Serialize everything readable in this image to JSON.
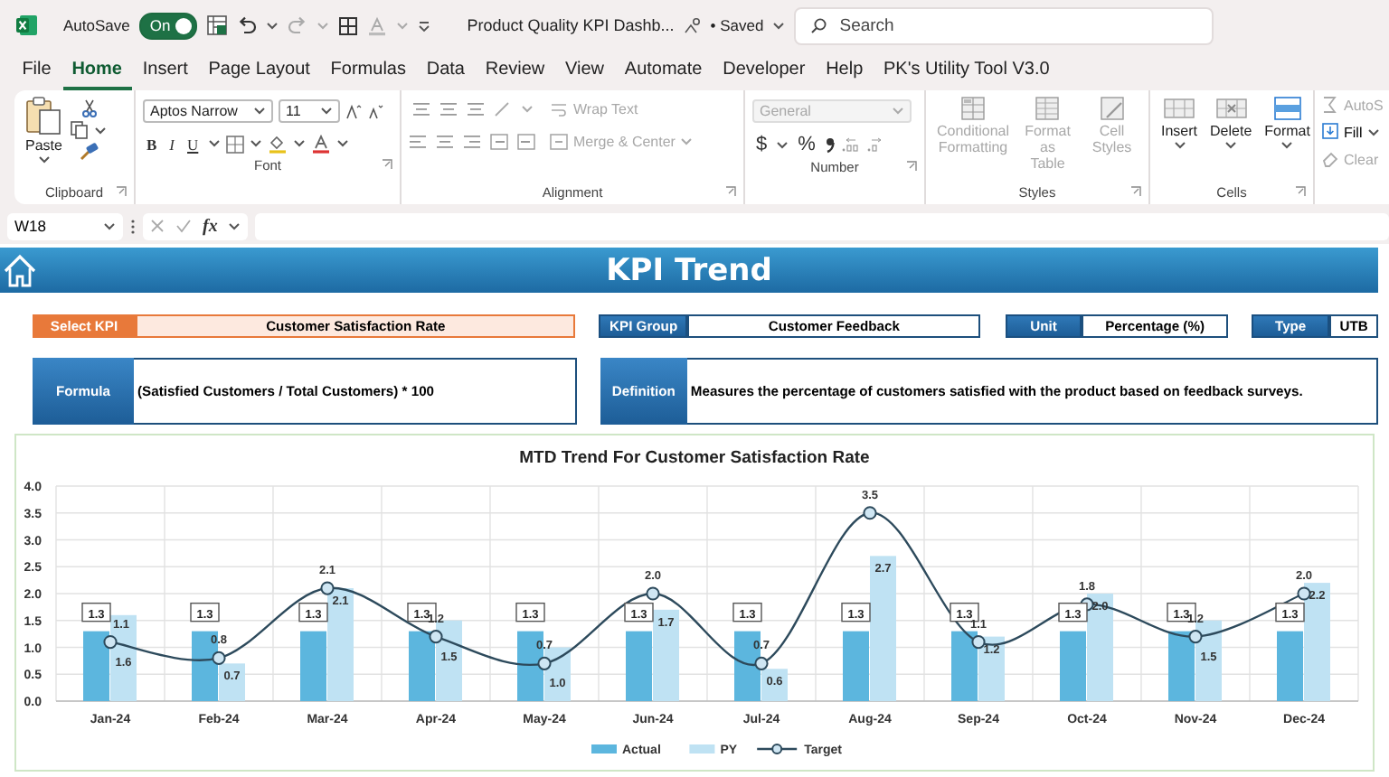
{
  "title_bar": {
    "autosave_label": "AutoSave",
    "autosave": {
      "label": "On",
      "on": true
    },
    "document_title": "Product Quality KPI Dashb...",
    "save_status": "• Saved",
    "search": {
      "placeholder": "Search"
    }
  },
  "tabs": [
    {
      "label": "File",
      "selected": false
    },
    {
      "label": "Home",
      "selected": true
    },
    {
      "label": "Insert",
      "selected": false
    },
    {
      "label": "Page Layout",
      "selected": false
    },
    {
      "label": "Formulas",
      "selected": false
    },
    {
      "label": "Data",
      "selected": false
    },
    {
      "label": "Review",
      "selected": false
    },
    {
      "label": "View",
      "selected": false
    },
    {
      "label": "Automate",
      "selected": false
    },
    {
      "label": "Developer",
      "selected": false
    },
    {
      "label": "Help",
      "selected": false
    },
    {
      "label": "PK's Utility Tool V3.0",
      "selected": false
    }
  ],
  "ribbon": {
    "clipboard": {
      "label": "Clipboard",
      "paste": "Paste"
    },
    "font": {
      "label": "Font",
      "font_name": "Aptos Narrow",
      "font_size": "11",
      "styles": [
        "B",
        "I",
        "U"
      ]
    },
    "alignment": {
      "label": "Alignment",
      "commands": [
        {
          "label": "Wrap Text",
          "disabled": true
        },
        {
          "label": "Merge & Center",
          "disabled": true
        }
      ]
    },
    "number": {
      "label": "Number",
      "format": {
        "value": "General",
        "disabled": true
      },
      "symbols": [
        "$",
        "%"
      ]
    },
    "styles": {
      "label": "Styles",
      "commands": [
        {
          "label": "Conditional Formatting",
          "disabled": true
        },
        {
          "label": "Format as Table",
          "disabled": true
        },
        {
          "label": "Cell Styles",
          "disabled": true
        }
      ]
    },
    "cells": {
      "label": "Cells",
      "commands": [
        {
          "label": "Insert",
          "disabled": false
        },
        {
          "label": "Delete",
          "disabled": false
        },
        {
          "label": "Format",
          "disabled": false
        }
      ]
    },
    "editing": {
      "commands": [
        {
          "label": "AutoS",
          "disabled": true
        },
        {
          "label": "Fill",
          "disabled": false
        },
        {
          "label": "Clear",
          "disabled": true
        }
      ]
    }
  },
  "formula_bar": {
    "name_box": "W18",
    "function_button": "fx"
  },
  "sheet": {
    "banner_title": "KPI Trend",
    "fields": [
      {
        "label": "Select KPI",
        "value": "Customer Satisfaction Rate",
        "kind": "select"
      },
      {
        "label": "KPI Group",
        "value": "Customer Feedback",
        "kind": "info"
      },
      {
        "label": "Unit",
        "value": "Percentage (%)",
        "kind": "info"
      },
      {
        "label": "Type",
        "value": "UTB",
        "kind": "info"
      }
    ],
    "details": [
      {
        "label": "Formula",
        "text": "(Satisfied Customers / Total Customers) * 100"
      },
      {
        "label": "Definition",
        "text": "Measures the percentage of customers satisfied with the product based on feedback surveys."
      }
    ],
    "chart_data": {
      "type": "bar",
      "title": "MTD Trend For Customer Satisfaction Rate",
      "categories": [
        "Jan-24",
        "Feb-24",
        "Mar-24",
        "Apr-24",
        "May-24",
        "Jun-24",
        "Jul-24",
        "Aug-24",
        "Sep-24",
        "Oct-24",
        "Nov-24",
        "Dec-24"
      ],
      "series": [
        {
          "name": "Actual",
          "type": "bar",
          "color": "#5cb6de",
          "values": [
            1.3,
            1.3,
            1.3,
            1.3,
            1.3,
            1.3,
            1.3,
            1.3,
            1.3,
            1.3,
            1.3,
            1.3
          ]
        },
        {
          "name": "PY",
          "type": "bar",
          "color": "#bfe2f3",
          "values": [
            1.6,
            0.7,
            2.1,
            1.5,
            1.0,
            1.7,
            0.6,
            2.7,
            1.2,
            2.0,
            1.5,
            2.2
          ]
        },
        {
          "name": "Target",
          "type": "line",
          "marker": "circle",
          "color": "#2d4a5c",
          "values": [
            1.1,
            0.8,
            2.1,
            1.2,
            0.7,
            2.0,
            0.7,
            3.5,
            1.1,
            1.8,
            1.2,
            2.0
          ]
        }
      ],
      "value_labels": [
        [
          "1.3",
          "1.3",
          "1.3",
          "1.3",
          "1.3",
          "1.3",
          "1.3",
          "1.3",
          "1.3",
          "1.3",
          "1.3",
          "1.3"
        ],
        [
          "1.6",
          "0.7",
          "2.1",
          "1.5",
          "1.0",
          "1.7",
          "0.6",
          "2.7",
          "1.2",
          "2.0",
          "1.5",
          "2.2"
        ],
        [
          "1.1",
          "0.8",
          "2.1",
          "1.2",
          "0.7",
          "2.0",
          "0.7",
          "3.5",
          "1.1",
          "1.8",
          "1.2",
          "2.0"
        ]
      ],
      "grid": true,
      "legend": "bottom",
      "ylim": [
        0,
        4
      ],
      "yticks": [
        {
          "value": 0,
          "label": "0.0"
        },
        {
          "value": 0.5,
          "label": "0.5"
        },
        {
          "value": 1,
          "label": "1.0"
        },
        {
          "value": 1.5,
          "label": "1.5"
        },
        {
          "value": 2,
          "label": "2.0"
        },
        {
          "value": 2.5,
          "label": "2.5"
        },
        {
          "value": 3,
          "label": "3.0"
        },
        {
          "value": 3.5,
          "label": "3.5"
        },
        {
          "value": 4,
          "label": "4.0"
        }
      ],
      "stacked": false
    }
  }
}
